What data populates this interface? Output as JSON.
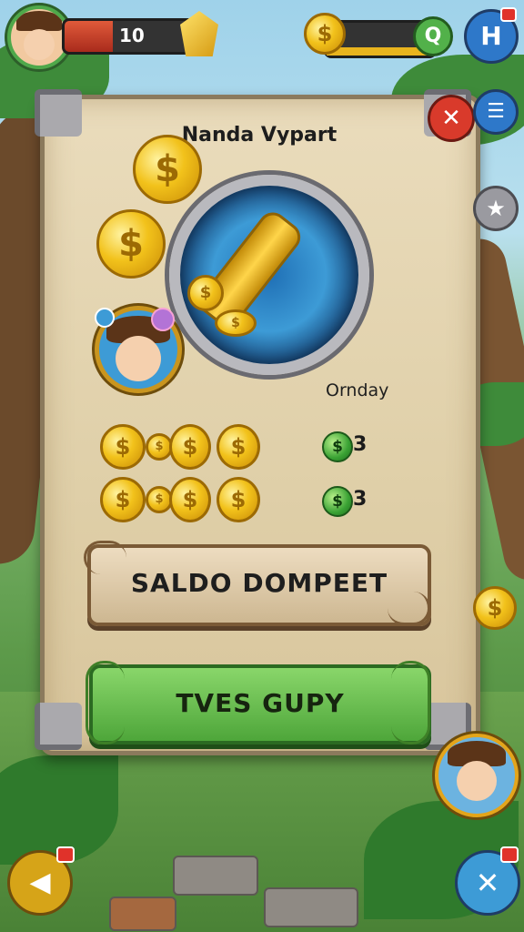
{
  "hud": {
    "level_value": "10",
    "hp_fraction": 0.35
  },
  "panel": {
    "title": "Nanda Vypart",
    "day_label": "Ornday",
    "reward_rows": [
      {
        "coins": [
          "$",
          "$",
          "$",
          "$"
        ],
        "count": "3"
      },
      {
        "coins": [
          "$",
          "$",
          "$",
          "$"
        ],
        "count": "3"
      }
    ],
    "buttons": {
      "primary_label": "SALDO DOMPEET",
      "secondary_label": "TVES GUPY"
    }
  },
  "icons": {
    "coin_symbol": "$",
    "search_symbol": "Q",
    "help_symbol": "H",
    "close_symbol": "✕",
    "menu_symbol": "☰",
    "star_symbol": "★",
    "back_symbol": "◀"
  },
  "colors": {
    "accent_green": "#4ea63a",
    "gold": "#f2c21b",
    "close_red": "#d93a2b",
    "blue_button": "#2e78c9"
  }
}
